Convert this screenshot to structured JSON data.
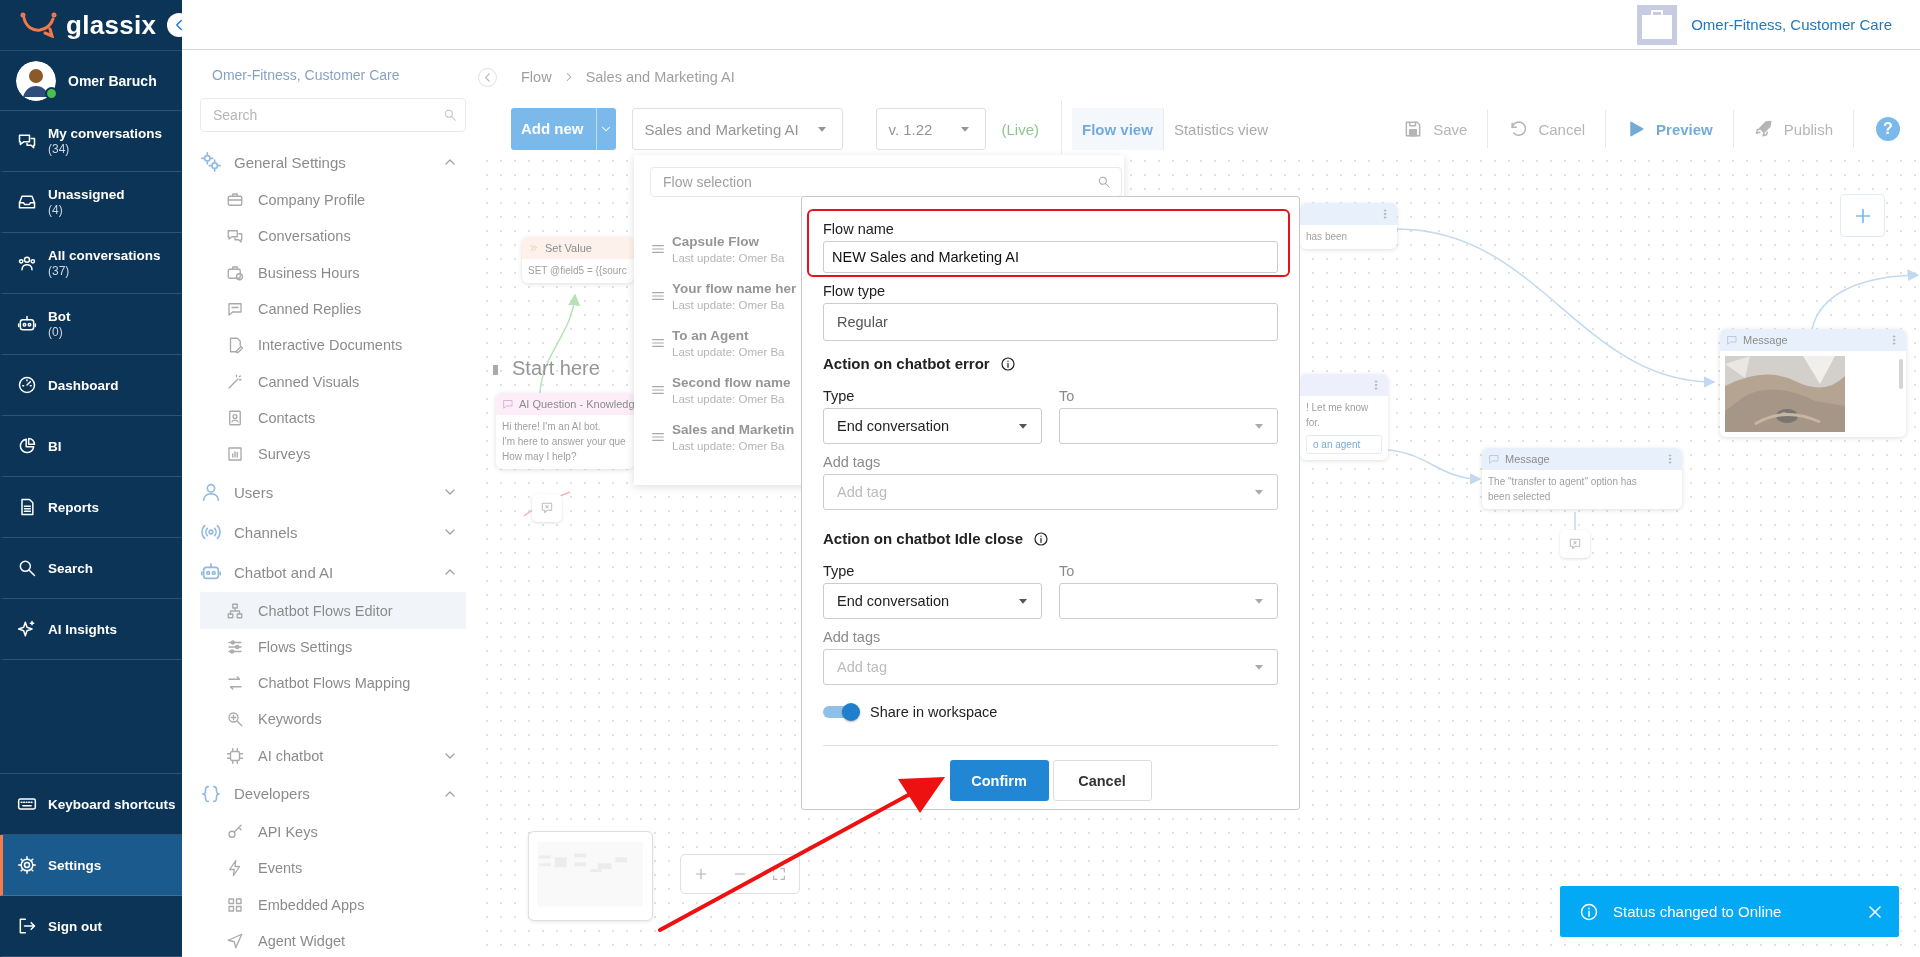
{
  "logo": {
    "text": "glassix"
  },
  "user": {
    "name": "Omer Baruch",
    "online": true
  },
  "nav": [
    {
      "label": "My conversations",
      "count": "(34)",
      "selected": false
    },
    {
      "label": "Unassigned",
      "count": "(4)",
      "selected": false
    },
    {
      "label": "All conversations",
      "count": "(37)",
      "selected": false
    },
    {
      "label": "Bot",
      "count": "(0)",
      "selected": false
    },
    {
      "label": "Dashboard",
      "selected": false
    },
    {
      "label": "BI",
      "selected": false
    },
    {
      "label": "Reports",
      "selected": false
    },
    {
      "label": "Search",
      "selected": false
    },
    {
      "label": "AI Insights",
      "selected": false
    }
  ],
  "nav_bottom": [
    {
      "label": "Keyboard shortcuts",
      "selected": false
    },
    {
      "label": "Settings",
      "selected": true
    },
    {
      "label": "Sign out",
      "selected": false
    }
  ],
  "header": {
    "account": "Omer-Fitness, Customer Care"
  },
  "settings_panel": {
    "title": "Omer-Fitness, Customer Care",
    "search": {
      "placeholder": "Search"
    },
    "groups": [
      {
        "label": "General Settings",
        "expanded": true,
        "children": [
          {
            "label": "Company Profile",
            "selected": false
          },
          {
            "label": "Conversations",
            "selected": false
          },
          {
            "label": "Business Hours",
            "selected": false
          },
          {
            "label": "Canned Replies",
            "selected": false
          },
          {
            "label": "Interactive Documents",
            "selected": false
          },
          {
            "label": "Canned Visuals",
            "selected": false
          },
          {
            "label": "Contacts",
            "selected": false
          },
          {
            "label": "Surveys",
            "selected": false
          }
        ]
      },
      {
        "label": "Users",
        "expanded": false
      },
      {
        "label": "Channels",
        "expanded": false
      },
      {
        "label": "Chatbot and AI",
        "expanded": true,
        "children": [
          {
            "label": "Chatbot Flows Editor",
            "selected": true
          },
          {
            "label": "Flows Settings",
            "selected": false
          },
          {
            "label": "Chatbot Flows Mapping",
            "selected": false
          },
          {
            "label": "Keywords",
            "selected": false
          },
          {
            "label": "AI chatbot",
            "selected": false,
            "expanded": false
          }
        ]
      },
      {
        "label": "Developers",
        "expanded": true,
        "children": [
          {
            "label": "API Keys",
            "selected": false
          },
          {
            "label": "Events",
            "selected": false
          },
          {
            "label": "Embedded Apps",
            "selected": false
          },
          {
            "label": "Agent Widget",
            "selected": false
          }
        ]
      }
    ]
  },
  "breadcrumb": [
    "Flow",
    "Sales and Marketing AI"
  ],
  "toolbar": {
    "add_button": "Add new",
    "flow_select": "Sales and Marketing AI",
    "version_select": "v. 1.22",
    "status": "(Live)",
    "view_tabs": [
      {
        "label": "Flow view",
        "selected": true
      },
      {
        "label": "Statistics view",
        "selected": false
      }
    ],
    "actions": [
      {
        "label": "Save",
        "disabled": true
      },
      {
        "label": "Cancel",
        "disabled": true
      },
      {
        "label": "Preview",
        "disabled": false
      },
      {
        "label": "Publish",
        "disabled": true
      }
    ],
    "help": "?"
  },
  "flow_selection": {
    "placeholder": "Flow selection",
    "items": [
      {
        "title": "Capsule Flow",
        "subtitle": "Last update: Omer Ba"
      },
      {
        "title": "Your flow name her",
        "subtitle": "Last update: Omer Ba"
      },
      {
        "title": "To an Agent",
        "subtitle": "Last update: Omer Ba"
      },
      {
        "title": "Second flow name",
        "subtitle": "Last update: Omer Ba"
      },
      {
        "title": "Sales and Marketin",
        "subtitle": "Last update: Omer Ba"
      }
    ]
  },
  "canvas": {
    "start_label": "Start here",
    "nodes": [
      {
        "kind": "set_value",
        "title": "Set Value",
        "lines": [
          "SET @field5 = {{sourc"
        ]
      },
      {
        "kind": "ai_question",
        "title": "AI Question - Knowledg",
        "lines": [
          "Hi there! I'm an AI bot.",
          "I'm here to answer your que",
          "How may I help?"
        ]
      },
      {
        "kind": "message",
        "lines": [
          "has been"
        ]
      },
      {
        "kind": "question",
        "lines": [
          "! Let me know",
          "for."
        ],
        "buttons": [
          "o an agent"
        ]
      },
      {
        "kind": "message",
        "title": "Message",
        "lines": [
          "The \"transfer to agent\" option has",
          "been selected"
        ]
      },
      {
        "kind": "media",
        "title": "Message"
      }
    ]
  },
  "dialog": {
    "flow_name": {
      "label": "Flow name",
      "value": "NEW Sales and Marketing AI"
    },
    "flow_type": {
      "label": "Flow type",
      "value": "Regular"
    },
    "sections": [
      {
        "title": "Action on chatbot error",
        "type": {
          "label": "Type",
          "value": "End conversation",
          "disabled": false
        },
        "to": {
          "label": "To",
          "disabled": true
        },
        "tags": {
          "label": "Add tags",
          "placeholder": "Add tag",
          "disabled": true
        }
      },
      {
        "title": "Action on chatbot Idle close",
        "type": {
          "label": "Type",
          "value": "End conversation",
          "disabled": false
        },
        "to": {
          "label": "To",
          "disabled": true
        },
        "tags": {
          "label": "Add tags",
          "placeholder": "Add tag",
          "disabled": true
        }
      }
    ],
    "share": {
      "label": "Share in workspace",
      "on": true
    },
    "buttons": [
      {
        "label": "Confirm",
        "kind": "primary"
      },
      {
        "label": "Cancel",
        "kind": "secondary"
      }
    ]
  },
  "toast": {
    "message": "Status changed to Online"
  }
}
